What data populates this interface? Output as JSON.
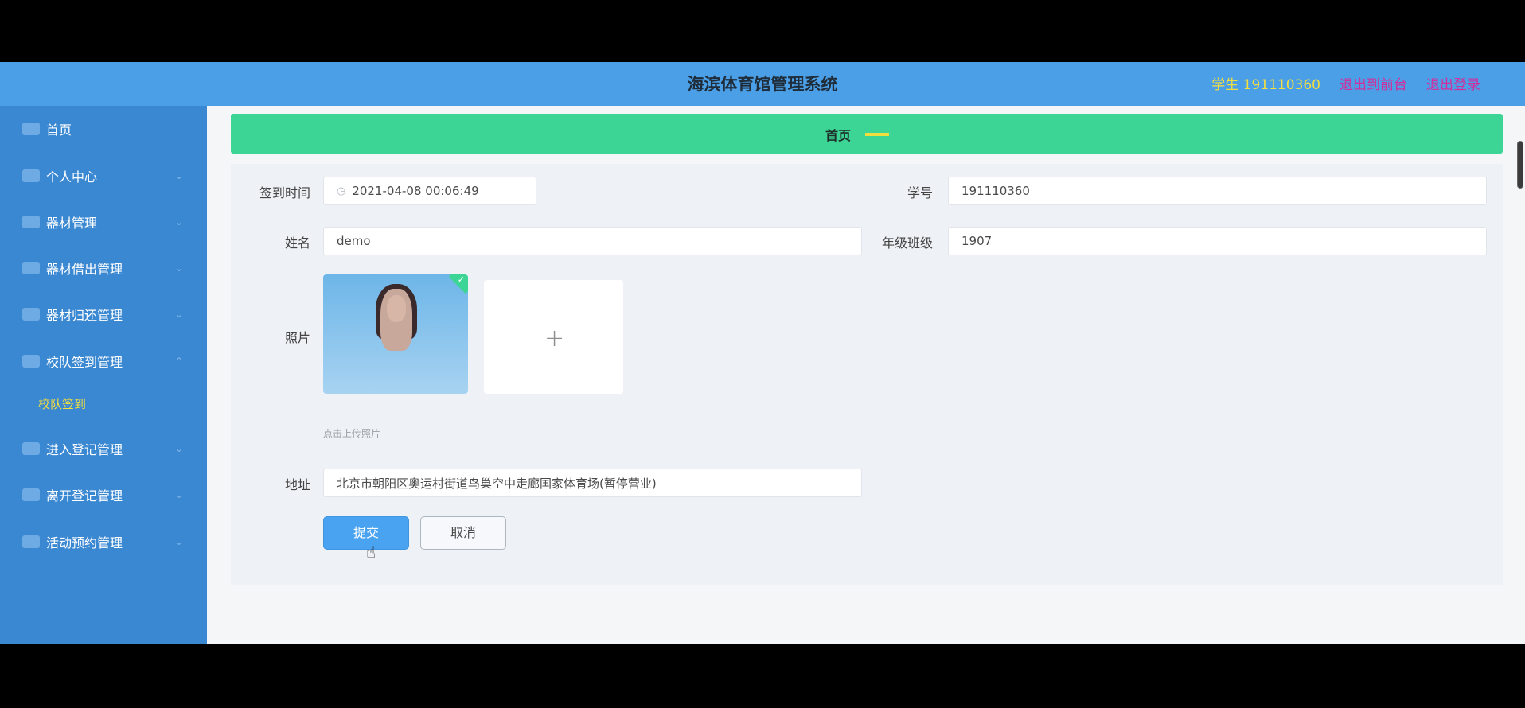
{
  "header": {
    "title": "海滨体育馆管理系统",
    "role_label": "学生 191110360",
    "btn_front": "退出到前台",
    "btn_logout": "退出登录"
  },
  "sidebar": {
    "items": [
      {
        "label": "首页",
        "icon": "home-icon"
      },
      {
        "label": "个人中心",
        "icon": "user-icon"
      },
      {
        "label": "器材管理",
        "icon": "equipment-icon"
      },
      {
        "label": "器材借出管理",
        "icon": "equipment-icon"
      },
      {
        "label": "器材归还管理",
        "icon": "equipment-icon"
      },
      {
        "label": "校队签到管理",
        "icon": "checkin-icon"
      },
      {
        "label": "进入登记管理",
        "icon": "entry-icon"
      },
      {
        "label": "离开登记管理",
        "icon": "exit-icon"
      },
      {
        "label": "活动预约管理",
        "icon": "calendar-icon"
      }
    ],
    "active_sub": "校队签到"
  },
  "breadcrumb": {
    "home": "首页"
  },
  "form": {
    "signin_time_label": "签到时间",
    "signin_time_value": "2021-04-08 00:06:49",
    "student_no_label": "学号",
    "student_no_value": "191110360",
    "name_label": "姓名",
    "name_value": "demo",
    "class_label": "年级班级",
    "class_value": "1907",
    "photo_label": "照片",
    "photo_hint": "点击上传照片",
    "address_label": "地址",
    "address_value": "北京市朝阳区奥运村街道鸟巢空中走廊国家体育场(暂停营业)",
    "submit_label": "提交",
    "cancel_label": "取消"
  },
  "colors": {
    "topbar": "#4b9fe6",
    "sidebar": "#3a87d2",
    "breadcrumb": "#3cd595",
    "accent_yellow": "#f3de3f",
    "accent_pink": "#d0309e"
  }
}
